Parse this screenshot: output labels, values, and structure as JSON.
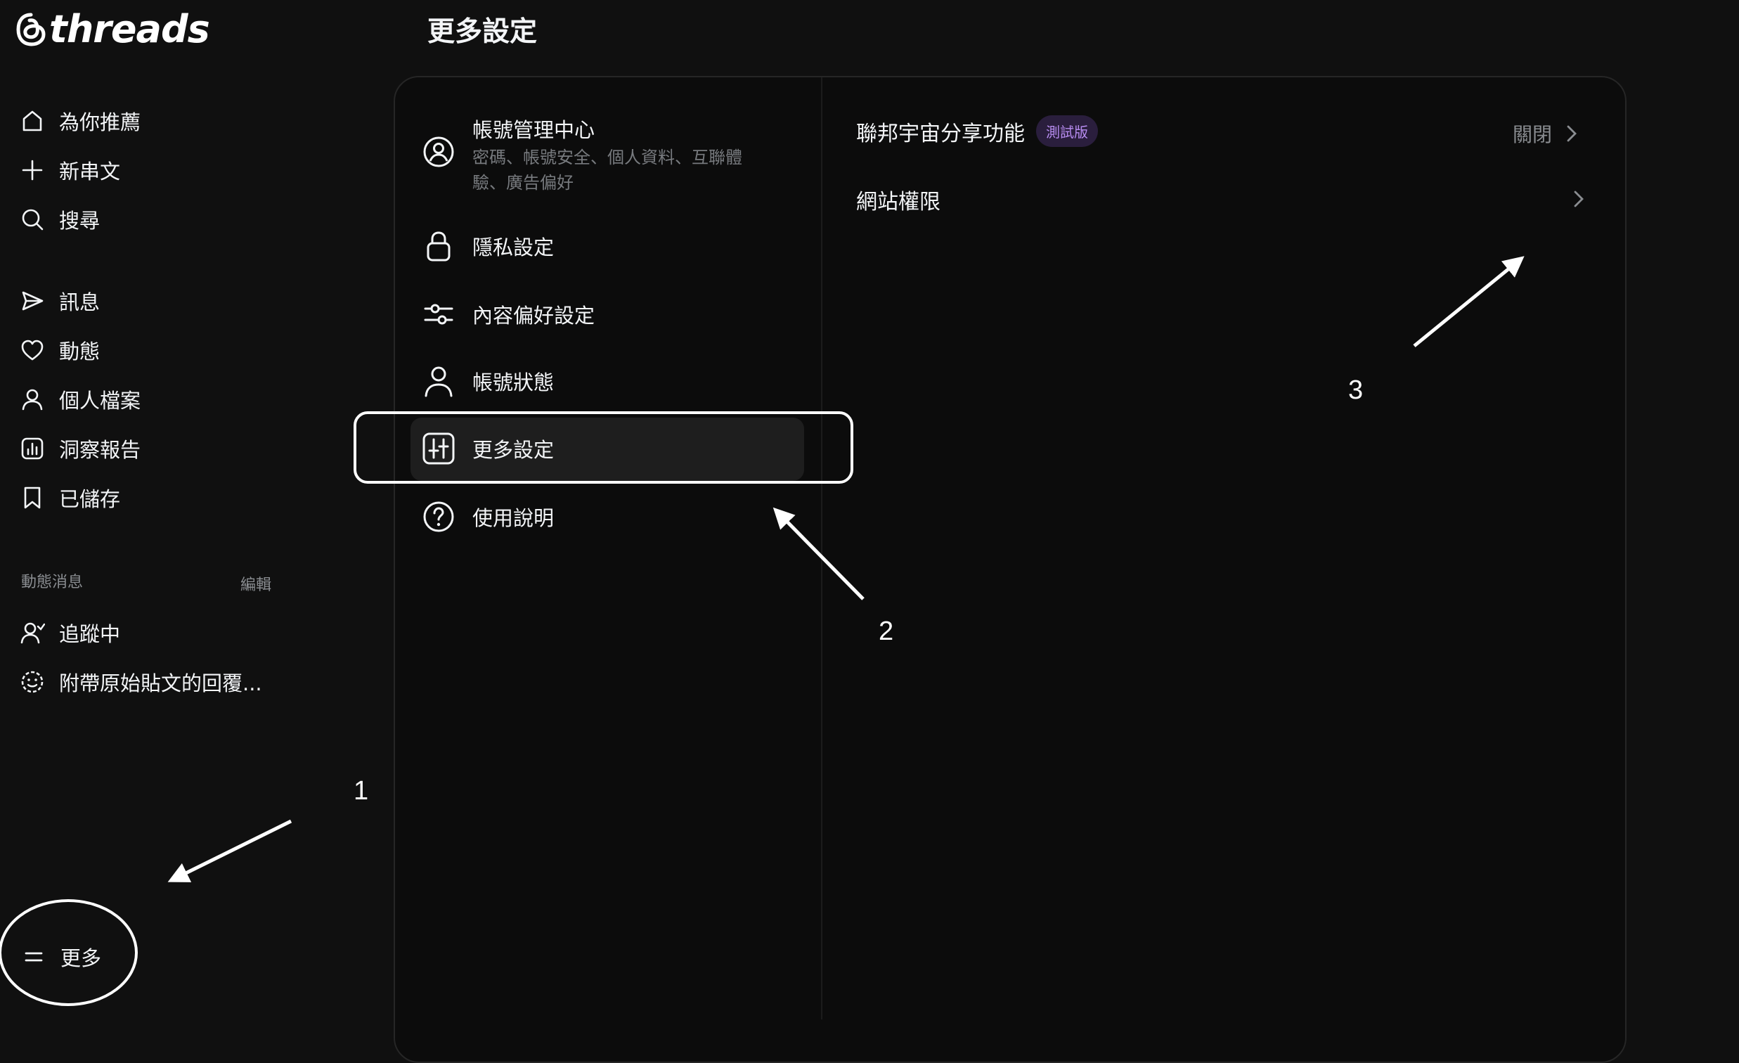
{
  "app": {
    "brand": "threads"
  },
  "page_title": "更多設定",
  "sidebar": {
    "nav": [
      {
        "label": "為你推薦",
        "icon": "home-icon"
      },
      {
        "label": "新串文",
        "icon": "plus-icon"
      },
      {
        "label": "搜尋",
        "icon": "search-icon"
      },
      {
        "label": "訊息",
        "icon": "send-icon"
      },
      {
        "label": "動態",
        "icon": "heart-icon"
      },
      {
        "label": "個人檔案",
        "icon": "person-icon"
      },
      {
        "label": "洞察報告",
        "icon": "chart-icon"
      },
      {
        "label": "已儲存",
        "icon": "bookmark-icon"
      }
    ],
    "feeds_title": "動態消息",
    "feeds_edit": "編輯",
    "feeds": [
      {
        "label": "追蹤中",
        "icon": "following-icon"
      },
      {
        "label": "附帶原始貼文的回覆...",
        "icon": "reply-face-icon"
      }
    ],
    "more_label": "更多"
  },
  "settings_menu": [
    {
      "title": "帳號管理中心",
      "subtitle_line1": "密碼、帳號安全、個人資料、互聯體",
      "subtitle_line2": "驗、廣告偏好",
      "icon": "account-center-icon"
    },
    {
      "title": "隱私設定",
      "icon": "lock-icon"
    },
    {
      "title": "內容偏好設定",
      "icon": "sliders-icon"
    },
    {
      "title": "帳號狀態",
      "icon": "user-icon"
    },
    {
      "title": "更多設定",
      "icon": "more-settings-icon",
      "active": true
    },
    {
      "title": "使用說明",
      "icon": "help-icon"
    }
  ],
  "detail": {
    "rows": [
      {
        "label": "聯邦宇宙分享功能",
        "badge": "測試版",
        "status": "關閉"
      },
      {
        "label": "網站權限"
      }
    ]
  },
  "annotations": {
    "n1": "1",
    "n2": "2",
    "n3": "3"
  },
  "colors": {
    "background": "#101010",
    "panel": "#0c0c0c",
    "badge_bg": "#2a1e3d",
    "badge_text": "#b78cf0",
    "muted": "#8a8d91",
    "annotation": "#ffffff"
  }
}
